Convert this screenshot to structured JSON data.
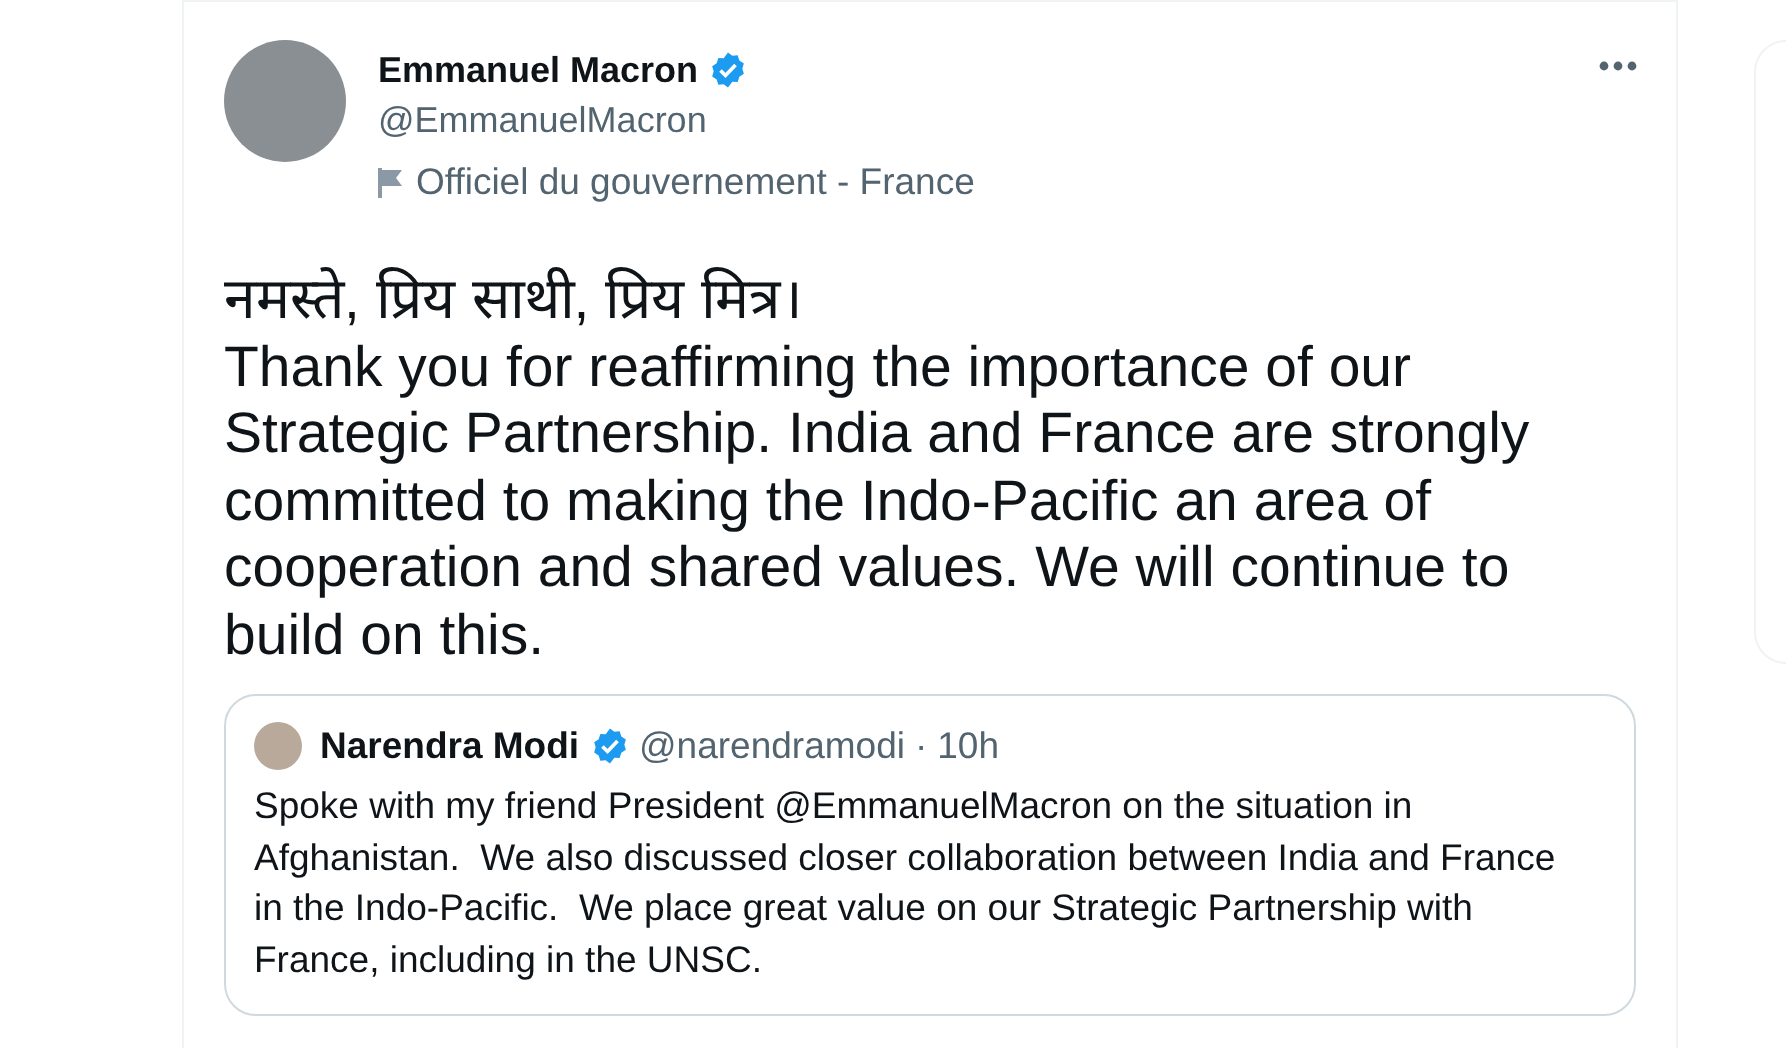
{
  "tweet": {
    "author": {
      "name": "Emmanuel Macron",
      "handle": "@EmmanuelMacron",
      "verified": true,
      "label": "Officiel du gouvernement - France"
    },
    "greeting": "नमस्ते, प्रिय साथी, प्रिय मित्र।",
    "text": "Thank you for reaffirming the importance of our Strategic Partnership. India and France are strongly committed to making the Indo-Pacific an area of cooperation and shared values. We will continue to build on this.",
    "quoted": {
      "name": "Narendra Modi",
      "verified": true,
      "handle": "@narendramodi",
      "separator": "·",
      "time": "10h",
      "text": "Spoke with my friend President @EmmanuelMacron on the situation in Afghanistan.  We also discussed closer collaboration between India and France in the Indo-Pacific.  We place great value on our Strategic Partnership with France, including in the UNSC."
    }
  }
}
